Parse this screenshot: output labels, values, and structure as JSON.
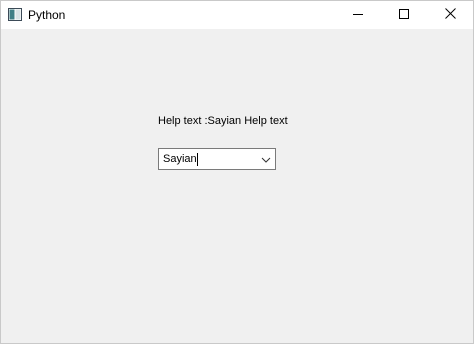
{
  "window": {
    "title": "Python",
    "icon": "python-window-icon",
    "controls": [
      "minimize-icon",
      "maximize-icon",
      "close-icon"
    ]
  },
  "main": {
    "help_label": "Help text :Sayian Help text",
    "combo": {
      "value": "Sayian",
      "dropdown_icon": "chevron-down-icon"
    }
  }
}
